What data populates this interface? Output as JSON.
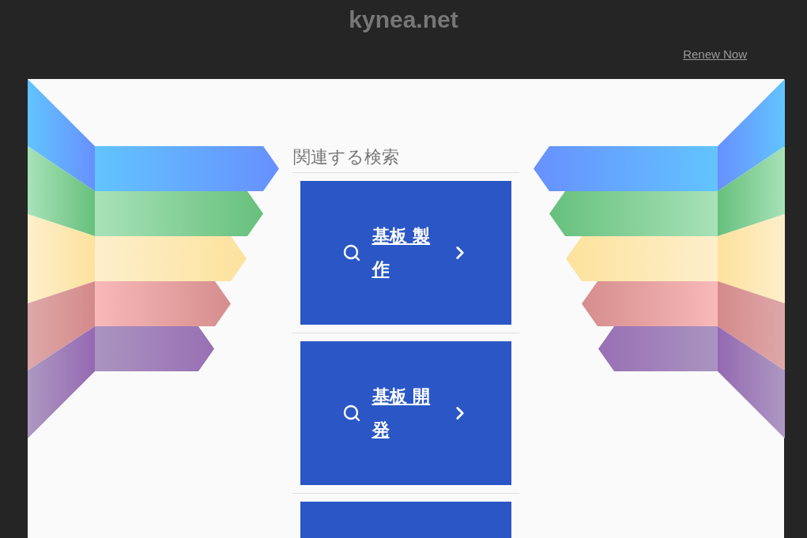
{
  "header": {
    "title": "kynea.net",
    "renew_link": "Renew Now"
  },
  "related": {
    "heading": "関連する検索",
    "items": [
      {
        "kind": "search",
        "label": "基板 製作"
      },
      {
        "kind": "search",
        "label": "基板 開発"
      },
      {
        "kind": "search"
      }
    ]
  }
}
